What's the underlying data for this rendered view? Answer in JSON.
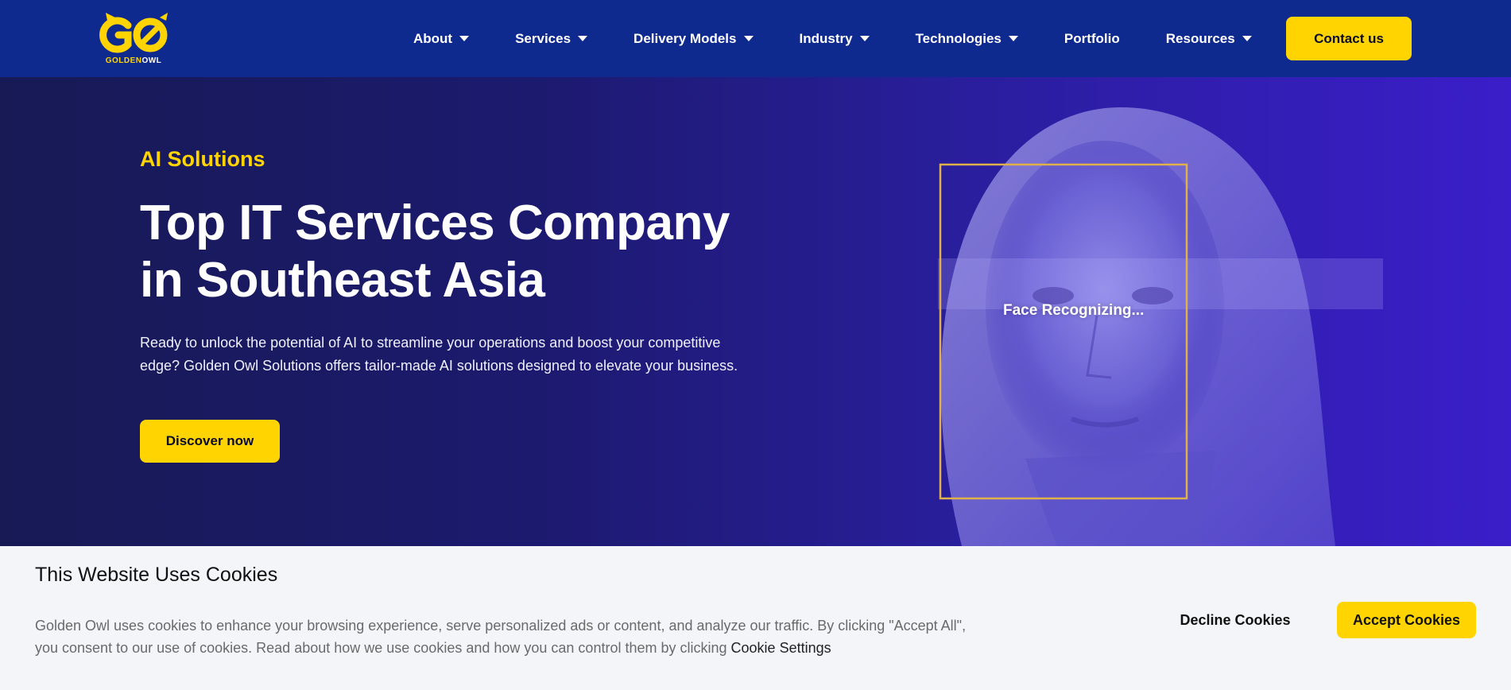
{
  "brand": {
    "logo_word_gold": "GOLDEN",
    "logo_word_white": "OWL",
    "colors": {
      "primary": "#0f2a8f",
      "accent": "#ffd400",
      "hero_start": "#171a55",
      "hero_end": "#3a1ec9"
    }
  },
  "nav": {
    "items": [
      {
        "label": "About",
        "has_dropdown": true
      },
      {
        "label": "Services",
        "has_dropdown": true
      },
      {
        "label": "Delivery Models",
        "has_dropdown": true
      },
      {
        "label": "Industry",
        "has_dropdown": true
      },
      {
        "label": "Technologies",
        "has_dropdown": true
      },
      {
        "label": "Portfolio",
        "has_dropdown": false
      },
      {
        "label": "Resources",
        "has_dropdown": true
      }
    ],
    "contact_label": "Contact us"
  },
  "hero": {
    "eyebrow": "AI Solutions",
    "headline_line1": "Top IT Services Company",
    "headline_line2": "in Southeast Asia",
    "description": "Ready to unlock the potential of AI to streamline your operations and boost your competitive edge? Golden Owl Solutions offers tailor-made AI solutions designed to elevate your business.",
    "cta_label": "Discover now",
    "scan_label": "Face Recognizing..."
  },
  "cookie": {
    "title": "This Website Uses Cookies",
    "text": "Golden Owl uses cookies to enhance your browsing experience, serve personalized ads or content, and analyze our traffic. By clicking \"Accept All\", you consent to our use of cookies. Read about how we use cookies and how you can control them by clicking",
    "settings_link": "Cookie Settings",
    "decline_label": "Decline Cookies",
    "accept_label": "Accept Cookies"
  }
}
